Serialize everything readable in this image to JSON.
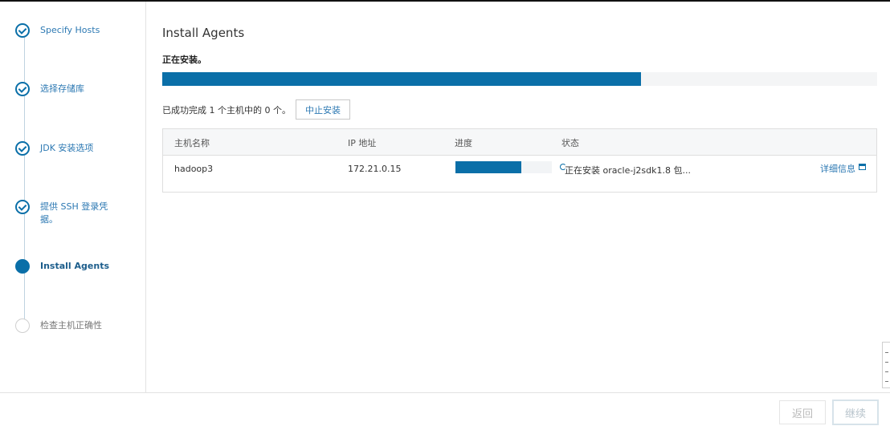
{
  "wizard": {
    "steps": [
      {
        "label": "Specify Hosts",
        "state": "done"
      },
      {
        "label": "选择存储库",
        "state": "done"
      },
      {
        "label": "JDK 安装选项",
        "state": "done"
      },
      {
        "label": "提供 SSH 登录凭据。",
        "state": "done"
      },
      {
        "label": "Install Agents",
        "state": "current"
      },
      {
        "label": "检查主机正确性",
        "state": "todo"
      }
    ]
  },
  "main": {
    "title": "Install Agents",
    "status": "正在安装。",
    "overall_progress_percent": 67,
    "summary": "已成功完成 1 个主机中的 0 个。",
    "abort_label": "中止安装",
    "table": {
      "headers": [
        "主机名称",
        "IP 地址",
        "进度",
        "状态"
      ],
      "rows": [
        {
          "hostname": "hadoop3",
          "ip": "172.21.0.15",
          "progress_percent": 68,
          "status": "正在安装 oracle-j2sdk1.8 包...",
          "details_label": "详细信息"
        }
      ]
    }
  },
  "footer": {
    "back_label": "返回",
    "next_label": "继续"
  },
  "colors": {
    "accent": "#0a6fa8",
    "link": "#2d79b3"
  }
}
